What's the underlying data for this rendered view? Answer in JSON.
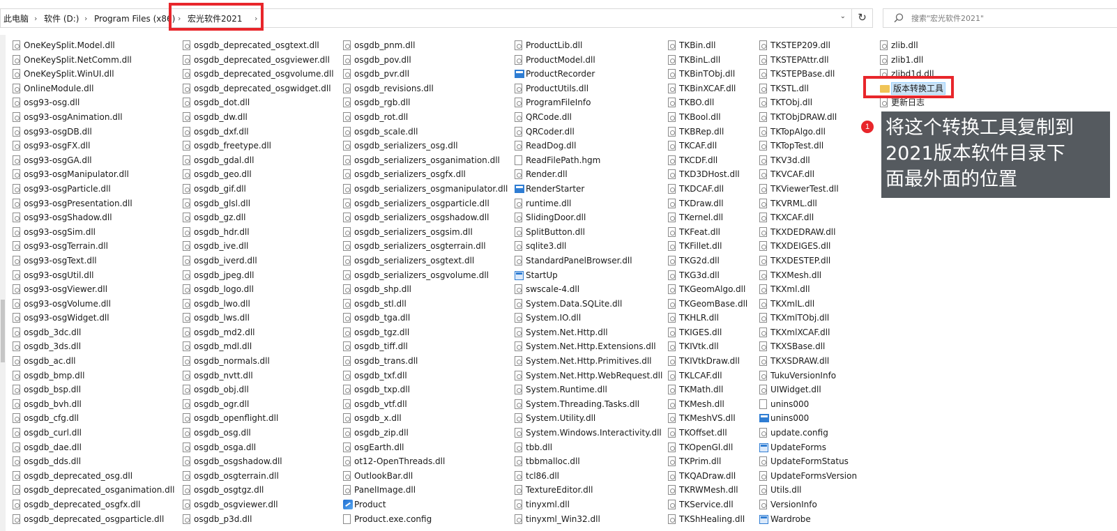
{
  "address_bar": {
    "crumbs": [
      "此电脑",
      "软件 (D:)",
      "Program Files (x86)",
      "宏光软件2021"
    ],
    "separator": "›",
    "refresh_symbol": "↻"
  },
  "search": {
    "placeholder": "搜索\"宏光软件2021\""
  },
  "callout": {
    "badge": "1",
    "lines": [
      "将这个转换工具复制到",
      "2021版本软件目录下",
      "面最外面的位置"
    ]
  },
  "highlight_color": "#e8262b",
  "columns": [
    {
      "items": [
        {
          "name": "OneKeySplit.Model.dll",
          "icon": "dll"
        },
        {
          "name": "OneKeySplit.NetComm.dll",
          "icon": "dll"
        },
        {
          "name": "OneKeySplit.WinUI.dll",
          "icon": "dll"
        },
        {
          "name": "OnlineModule.dll",
          "icon": "dll"
        },
        {
          "name": "osg93-osg.dll",
          "icon": "dll"
        },
        {
          "name": "osg93-osgAnimation.dll",
          "icon": "dll"
        },
        {
          "name": "osg93-osgDB.dll",
          "icon": "dll"
        },
        {
          "name": "osg93-osgFX.dll",
          "icon": "dll"
        },
        {
          "name": "osg93-osgGA.dll",
          "icon": "dll"
        },
        {
          "name": "osg93-osgManipulator.dll",
          "icon": "dll"
        },
        {
          "name": "osg93-osgParticle.dll",
          "icon": "dll"
        },
        {
          "name": "osg93-osgPresentation.dll",
          "icon": "dll"
        },
        {
          "name": "osg93-osgShadow.dll",
          "icon": "dll"
        },
        {
          "name": "osg93-osgSim.dll",
          "icon": "dll"
        },
        {
          "name": "osg93-osgTerrain.dll",
          "icon": "dll"
        },
        {
          "name": "osg93-osgText.dll",
          "icon": "dll"
        },
        {
          "name": "osg93-osgUtil.dll",
          "icon": "dll"
        },
        {
          "name": "osg93-osgViewer.dll",
          "icon": "dll"
        },
        {
          "name": "osg93-osgVolume.dll",
          "icon": "dll"
        },
        {
          "name": "osg93-osgWidget.dll",
          "icon": "dll"
        },
        {
          "name": "osgdb_3dc.dll",
          "icon": "dll"
        },
        {
          "name": "osgdb_3ds.dll",
          "icon": "dll"
        },
        {
          "name": "osgdb_ac.dll",
          "icon": "dll"
        },
        {
          "name": "osgdb_bmp.dll",
          "icon": "dll"
        },
        {
          "name": "osgdb_bsp.dll",
          "icon": "dll"
        },
        {
          "name": "osgdb_bvh.dll",
          "icon": "dll"
        },
        {
          "name": "osgdb_cfg.dll",
          "icon": "dll"
        },
        {
          "name": "osgdb_curl.dll",
          "icon": "dll"
        },
        {
          "name": "osgdb_dae.dll",
          "icon": "dll"
        },
        {
          "name": "osgdb_dds.dll",
          "icon": "dll"
        },
        {
          "name": "osgdb_deprecated_osg.dll",
          "icon": "dll"
        },
        {
          "name": "osgdb_deprecated_osganimation.dll",
          "icon": "dll"
        },
        {
          "name": "osgdb_deprecated_osgfx.dll",
          "icon": "dll"
        },
        {
          "name": "osgdb_deprecated_osgparticle.dll",
          "icon": "dll"
        }
      ]
    },
    {
      "items": [
        {
          "name": "osgdb_deprecated_osgtext.dll",
          "icon": "dll"
        },
        {
          "name": "osgdb_deprecated_osgviewer.dll",
          "icon": "dll"
        },
        {
          "name": "osgdb_deprecated_osgvolume.dll",
          "icon": "dll"
        },
        {
          "name": "osgdb_deprecated_osgwidget.dll",
          "icon": "dll"
        },
        {
          "name": "osgdb_dot.dll",
          "icon": "dll"
        },
        {
          "name": "osgdb_dw.dll",
          "icon": "dll"
        },
        {
          "name": "osgdb_dxf.dll",
          "icon": "dll"
        },
        {
          "name": "osgdb_freetype.dll",
          "icon": "dll"
        },
        {
          "name": "osgdb_gdal.dll",
          "icon": "dll"
        },
        {
          "name": "osgdb_geo.dll",
          "icon": "dll"
        },
        {
          "name": "osgdb_gif.dll",
          "icon": "dll"
        },
        {
          "name": "osgdb_glsl.dll",
          "icon": "dll"
        },
        {
          "name": "osgdb_gz.dll",
          "icon": "dll"
        },
        {
          "name": "osgdb_hdr.dll",
          "icon": "dll"
        },
        {
          "name": "osgdb_ive.dll",
          "icon": "dll"
        },
        {
          "name": "osgdb_iverd.dll",
          "icon": "dll"
        },
        {
          "name": "osgdb_jpeg.dll",
          "icon": "dll"
        },
        {
          "name": "osgdb_logo.dll",
          "icon": "dll"
        },
        {
          "name": "osgdb_lwo.dll",
          "icon": "dll"
        },
        {
          "name": "osgdb_lws.dll",
          "icon": "dll"
        },
        {
          "name": "osgdb_md2.dll",
          "icon": "dll"
        },
        {
          "name": "osgdb_mdl.dll",
          "icon": "dll"
        },
        {
          "name": "osgdb_normals.dll",
          "icon": "dll"
        },
        {
          "name": "osgdb_nvtt.dll",
          "icon": "dll"
        },
        {
          "name": "osgdb_obj.dll",
          "icon": "dll"
        },
        {
          "name": "osgdb_ogr.dll",
          "icon": "dll"
        },
        {
          "name": "osgdb_openflight.dll",
          "icon": "dll"
        },
        {
          "name": "osgdb_osg.dll",
          "icon": "dll"
        },
        {
          "name": "osgdb_osga.dll",
          "icon": "dll"
        },
        {
          "name": "osgdb_osgshadow.dll",
          "icon": "dll"
        },
        {
          "name": "osgdb_osgterrain.dll",
          "icon": "dll"
        },
        {
          "name": "osgdb_osgtgz.dll",
          "icon": "dll"
        },
        {
          "name": "osgdb_osgviewer.dll",
          "icon": "dll"
        },
        {
          "name": "osgdb_p3d.dll",
          "icon": "dll"
        }
      ]
    },
    {
      "items": [
        {
          "name": "osgdb_pnm.dll",
          "icon": "dll"
        },
        {
          "name": "osgdb_pov.dll",
          "icon": "dll"
        },
        {
          "name": "osgdb_pvr.dll",
          "icon": "dll"
        },
        {
          "name": "osgdb_revisions.dll",
          "icon": "dll"
        },
        {
          "name": "osgdb_rgb.dll",
          "icon": "dll"
        },
        {
          "name": "osgdb_rot.dll",
          "icon": "dll"
        },
        {
          "name": "osgdb_scale.dll",
          "icon": "dll"
        },
        {
          "name": "osgdb_serializers_osg.dll",
          "icon": "dll"
        },
        {
          "name": "osgdb_serializers_osganimation.dll",
          "icon": "dll"
        },
        {
          "name": "osgdb_serializers_osgfx.dll",
          "icon": "dll"
        },
        {
          "name": "osgdb_serializers_osgmanipulator.dll",
          "icon": "dll"
        },
        {
          "name": "osgdb_serializers_osgparticle.dll",
          "icon": "dll"
        },
        {
          "name": "osgdb_serializers_osgshadow.dll",
          "icon": "dll"
        },
        {
          "name": "osgdb_serializers_osgsim.dll",
          "icon": "dll"
        },
        {
          "name": "osgdb_serializers_osgterrain.dll",
          "icon": "dll"
        },
        {
          "name": "osgdb_serializers_osgtext.dll",
          "icon": "dll"
        },
        {
          "name": "osgdb_serializers_osgvolume.dll",
          "icon": "dll"
        },
        {
          "name": "osgdb_shp.dll",
          "icon": "dll"
        },
        {
          "name": "osgdb_stl.dll",
          "icon": "dll"
        },
        {
          "name": "osgdb_tga.dll",
          "icon": "dll"
        },
        {
          "name": "osgdb_tgz.dll",
          "icon": "dll"
        },
        {
          "name": "osgdb_tiff.dll",
          "icon": "dll"
        },
        {
          "name": "osgdb_trans.dll",
          "icon": "dll"
        },
        {
          "name": "osgdb_txf.dll",
          "icon": "dll"
        },
        {
          "name": "osgdb_txp.dll",
          "icon": "dll"
        },
        {
          "name": "osgdb_vtf.dll",
          "icon": "dll"
        },
        {
          "name": "osgdb_x.dll",
          "icon": "dll"
        },
        {
          "name": "osgdb_zip.dll",
          "icon": "dll"
        },
        {
          "name": "osgEarth.dll",
          "icon": "dll"
        },
        {
          "name": "ot12-OpenThreads.dll",
          "icon": "dll"
        },
        {
          "name": "OutlookBar.dll",
          "icon": "dll"
        },
        {
          "name": "PanelImage.dll",
          "icon": "dll"
        },
        {
          "name": "Product",
          "icon": "exe"
        },
        {
          "name": "Product.exe.config",
          "icon": "file"
        }
      ]
    },
    {
      "items": [
        {
          "name": "ProductLib.dll",
          "icon": "dll"
        },
        {
          "name": "ProductModel.dll",
          "icon": "dll"
        },
        {
          "name": "ProductRecorder",
          "icon": "app"
        },
        {
          "name": "ProductUtils.dll",
          "icon": "dll"
        },
        {
          "name": "ProgramFileInfo",
          "icon": "dll"
        },
        {
          "name": "QRCode.dll",
          "icon": "dll"
        },
        {
          "name": "QRCoder.dll",
          "icon": "dll"
        },
        {
          "name": "ReadDog.dll",
          "icon": "dll"
        },
        {
          "name": "ReadFilePath.hgm",
          "icon": "file"
        },
        {
          "name": "Render.dll",
          "icon": "dll"
        },
        {
          "name": "RenderStarter",
          "icon": "app"
        },
        {
          "name": "runtime.dll",
          "icon": "dll"
        },
        {
          "name": "SlidingDoor.dll",
          "icon": "dll"
        },
        {
          "name": "SplitButton.dll",
          "icon": "dll"
        },
        {
          "name": "sqlite3.dll",
          "icon": "dll"
        },
        {
          "name": "StandardPanelBrowser.dll",
          "icon": "dll"
        },
        {
          "name": "StartUp",
          "icon": "form"
        },
        {
          "name": "swscale-4.dll",
          "icon": "dll"
        },
        {
          "name": "System.Data.SQLite.dll",
          "icon": "dll"
        },
        {
          "name": "System.IO.dll",
          "icon": "dll"
        },
        {
          "name": "System.Net.Http.dll",
          "icon": "dll"
        },
        {
          "name": "System.Net.Http.Extensions.dll",
          "icon": "dll"
        },
        {
          "name": "System.Net.Http.Primitives.dll",
          "icon": "dll"
        },
        {
          "name": "System.Net.Http.WebRequest.dll",
          "icon": "dll"
        },
        {
          "name": "System.Runtime.dll",
          "icon": "dll"
        },
        {
          "name": "System.Threading.Tasks.dll",
          "icon": "dll"
        },
        {
          "name": "System.Utility.dll",
          "icon": "dll"
        },
        {
          "name": "System.Windows.Interactivity.dll",
          "icon": "dll"
        },
        {
          "name": "tbb.dll",
          "icon": "dll"
        },
        {
          "name": "tbbmalloc.dll",
          "icon": "dll"
        },
        {
          "name": "tcl86.dll",
          "icon": "dll"
        },
        {
          "name": "TextureEditor.dll",
          "icon": "dll"
        },
        {
          "name": "tinyxml.dll",
          "icon": "dll"
        },
        {
          "name": "tinyxml_Win32.dll",
          "icon": "dll"
        }
      ]
    },
    {
      "items": [
        {
          "name": "TKBin.dll",
          "icon": "dll"
        },
        {
          "name": "TKBinL.dll",
          "icon": "dll"
        },
        {
          "name": "TKBinTObj.dll",
          "icon": "dll"
        },
        {
          "name": "TKBinXCAF.dll",
          "icon": "dll"
        },
        {
          "name": "TKBO.dll",
          "icon": "dll"
        },
        {
          "name": "TKBool.dll",
          "icon": "dll"
        },
        {
          "name": "TKBRep.dll",
          "icon": "dll"
        },
        {
          "name": "TKCAF.dll",
          "icon": "dll"
        },
        {
          "name": "TKCDF.dll",
          "icon": "dll"
        },
        {
          "name": "TKD3DHost.dll",
          "icon": "dll"
        },
        {
          "name": "TKDCAF.dll",
          "icon": "dll"
        },
        {
          "name": "TKDraw.dll",
          "icon": "dll"
        },
        {
          "name": "TKernel.dll",
          "icon": "dll"
        },
        {
          "name": "TKFeat.dll",
          "icon": "dll"
        },
        {
          "name": "TKFillet.dll",
          "icon": "dll"
        },
        {
          "name": "TKG2d.dll",
          "icon": "dll"
        },
        {
          "name": "TKG3d.dll",
          "icon": "dll"
        },
        {
          "name": "TKGeomAlgo.dll",
          "icon": "dll"
        },
        {
          "name": "TKGeomBase.dll",
          "icon": "dll"
        },
        {
          "name": "TKHLR.dll",
          "icon": "dll"
        },
        {
          "name": "TKIGES.dll",
          "icon": "dll"
        },
        {
          "name": "TKIVtk.dll",
          "icon": "dll"
        },
        {
          "name": "TKIVtkDraw.dll",
          "icon": "dll"
        },
        {
          "name": "TKLCAF.dll",
          "icon": "dll"
        },
        {
          "name": "TKMath.dll",
          "icon": "dll"
        },
        {
          "name": "TKMesh.dll",
          "icon": "dll"
        },
        {
          "name": "TKMeshVS.dll",
          "icon": "dll"
        },
        {
          "name": "TKOffset.dll",
          "icon": "dll"
        },
        {
          "name": "TKOpenGl.dll",
          "icon": "dll"
        },
        {
          "name": "TKPrim.dll",
          "icon": "dll"
        },
        {
          "name": "TKQADraw.dll",
          "icon": "dll"
        },
        {
          "name": "TKRWMesh.dll",
          "icon": "dll"
        },
        {
          "name": "TKService.dll",
          "icon": "dll"
        },
        {
          "name": "TKShHealing.dll",
          "icon": "dll"
        }
      ]
    },
    {
      "items": [
        {
          "name": "TKSTEP209.dll",
          "icon": "dll"
        },
        {
          "name": "TKSTEPAttr.dll",
          "icon": "dll"
        },
        {
          "name": "TKSTEPBase.dll",
          "icon": "dll"
        },
        {
          "name": "TKSTL.dll",
          "icon": "dll"
        },
        {
          "name": "TKTObj.dll",
          "icon": "dll"
        },
        {
          "name": "TKTObjDRAW.dll",
          "icon": "dll"
        },
        {
          "name": "TKTopAlgo.dll",
          "icon": "dll"
        },
        {
          "name": "TKTopTest.dll",
          "icon": "dll"
        },
        {
          "name": "TKV3d.dll",
          "icon": "dll"
        },
        {
          "name": "TKVCAF.dll",
          "icon": "dll"
        },
        {
          "name": "TKViewerTest.dll",
          "icon": "dll"
        },
        {
          "name": "TKVRML.dll",
          "icon": "dll"
        },
        {
          "name": "TKXCAF.dll",
          "icon": "dll"
        },
        {
          "name": "TKXDEDRAW.dll",
          "icon": "dll"
        },
        {
          "name": "TKXDEIGES.dll",
          "icon": "dll"
        },
        {
          "name": "TKXDESTEP.dll",
          "icon": "dll"
        },
        {
          "name": "TKXMesh.dll",
          "icon": "dll"
        },
        {
          "name": "TKXml.dll",
          "icon": "dll"
        },
        {
          "name": "TKXmlL.dll",
          "icon": "dll"
        },
        {
          "name": "TKXmlTObj.dll",
          "icon": "dll"
        },
        {
          "name": "TKXmlXCAF.dll",
          "icon": "dll"
        },
        {
          "name": "TKXSBase.dll",
          "icon": "dll"
        },
        {
          "name": "TKXSDRAW.dll",
          "icon": "dll"
        },
        {
          "name": "TukuVersionInfo",
          "icon": "dll"
        },
        {
          "name": "UIWidget.dll",
          "icon": "dll"
        },
        {
          "name": "unins000",
          "icon": "file"
        },
        {
          "name": "unins000",
          "icon": "app"
        },
        {
          "name": "update.config",
          "icon": "dll"
        },
        {
          "name": "UpdateForms",
          "icon": "form"
        },
        {
          "name": "UpdateFormStatus",
          "icon": "dll"
        },
        {
          "name": "UpdateFormsVersion",
          "icon": "dll"
        },
        {
          "name": "Utils.dll",
          "icon": "dll"
        },
        {
          "name": "VersionInfo",
          "icon": "dll"
        },
        {
          "name": "Wardrobe",
          "icon": "form"
        }
      ]
    },
    {
      "items": [
        {
          "name": "zlib.dll",
          "icon": "dll"
        },
        {
          "name": "zlib1.dll",
          "icon": "dll"
        },
        {
          "name": "zlibd1d.dll",
          "icon": "dll"
        },
        {
          "name": "版本转换工具",
          "icon": "folder",
          "selected": true
        },
        {
          "name": "更新日志",
          "icon": "dll"
        }
      ]
    }
  ]
}
